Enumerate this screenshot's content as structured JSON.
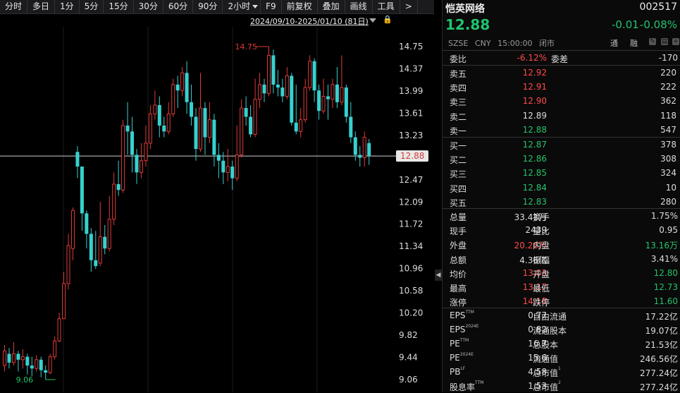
{
  "toolbar": {
    "items": [
      "分时",
      "多日",
      "1分",
      "5分",
      "15分",
      "30分",
      "60分",
      "90分",
      "2小时",
      "F9",
      "前复权",
      "叠加",
      "画线",
      "工具",
      ">"
    ]
  },
  "chart": {
    "range": "2024/09/10-2025/01/10 (81日)",
    "current_price_tag": "12.88",
    "high_marker": "14.75",
    "low_marker": "9.06",
    "y_ticks": [
      "14.75",
      "14.37",
      "13.99",
      "13.61",
      "13.23",
      "12.85",
      "12.47",
      "12.09",
      "11.72",
      "11.34",
      "10.96",
      "10.58",
      "10.20",
      "9.82",
      "9.44",
      "9.06"
    ],
    "colors": {
      "up": "#e03a3a",
      "down": "#36d1cf",
      "last_line": "#d0d0d0"
    }
  },
  "chart_data": {
    "type": "candlestick",
    "ylim": [
      9.06,
      14.75
    ],
    "current": 12.88,
    "candles": [
      [
        9.3,
        9.55,
        9.65,
        9.2
      ],
      [
        9.5,
        9.35,
        9.6,
        9.25
      ],
      [
        9.35,
        9.5,
        9.7,
        9.3
      ],
      [
        9.5,
        9.4,
        9.55,
        9.2
      ],
      [
        9.4,
        9.45,
        9.58,
        9.25
      ],
      [
        9.45,
        9.3,
        9.5,
        9.15
      ],
      [
        9.3,
        9.25,
        9.45,
        9.12
      ],
      [
        9.25,
        9.4,
        9.48,
        9.2
      ],
      [
        9.4,
        9.22,
        9.45,
        9.1
      ],
      [
        9.22,
        9.18,
        9.3,
        9.06
      ],
      [
        9.18,
        9.45,
        9.5,
        9.15
      ],
      [
        9.45,
        9.72,
        9.8,
        9.4
      ],
      [
        9.72,
        10.1,
        10.2,
        9.7
      ],
      [
        10.1,
        10.7,
        10.9,
        10.1
      ],
      [
        10.7,
        11.35,
        11.55,
        10.6
      ],
      [
        11.3,
        11.95,
        12.0,
        11.1
      ],
      [
        12.95,
        12.7,
        13.05,
        12.5
      ],
      [
        12.7,
        11.9,
        12.4,
        11.6
      ],
      [
        11.9,
        11.55,
        11.95,
        11.3
      ],
      [
        11.55,
        11.1,
        11.65,
        10.9
      ],
      [
        11.1,
        11.0,
        11.6,
        10.95
      ],
      [
        11.05,
        11.5,
        12.1,
        11.0
      ],
      [
        11.5,
        11.3,
        11.7,
        11.2
      ],
      [
        11.3,
        11.8,
        12.2,
        11.25
      ],
      [
        11.8,
        12.4,
        12.6,
        11.7
      ],
      [
        12.4,
        12.3,
        12.8,
        12.2
      ],
      [
        12.3,
        13.4,
        13.5,
        12.25
      ],
      [
        13.4,
        13.3,
        13.8,
        12.9
      ],
      [
        13.3,
        12.9,
        13.55,
        12.6
      ],
      [
        12.9,
        12.6,
        13.0,
        12.4
      ],
      [
        12.6,
        12.8,
        13.1,
        12.5
      ],
      [
        12.8,
        13.1,
        13.4,
        12.7
      ],
      [
        13.1,
        13.6,
        13.75,
        13.0
      ],
      [
        13.6,
        13.75,
        14.0,
        13.5
      ],
      [
        13.75,
        13.4,
        13.9,
        13.2
      ],
      [
        13.4,
        13.3,
        13.55,
        13.2
      ],
      [
        13.3,
        13.6,
        13.8,
        13.25
      ],
      [
        13.6,
        14.1,
        14.2,
        13.55
      ],
      [
        14.1,
        14.0,
        14.25,
        13.7
      ],
      [
        14.0,
        14.3,
        14.4,
        13.9
      ],
      [
        14.3,
        13.8,
        14.5,
        13.6
      ],
      [
        13.8,
        13.55,
        14.1,
        13.4
      ],
      [
        13.55,
        13.0,
        13.7,
        12.8
      ],
      [
        13.0,
        13.7,
        14.3,
        12.95
      ],
      [
        13.7,
        13.2,
        13.8,
        12.9
      ],
      [
        13.2,
        13.5,
        13.8,
        13.1
      ],
      [
        13.5,
        12.9,
        13.6,
        12.7
      ],
      [
        12.9,
        12.8,
        13.1,
        12.5
      ],
      [
        12.8,
        12.6,
        12.95,
        12.4
      ],
      [
        12.6,
        12.7,
        13.0,
        12.45
      ],
      [
        12.7,
        12.5,
        12.8,
        12.3
      ],
      [
        12.5,
        12.9,
        13.4,
        12.45
      ],
      [
        12.9,
        13.7,
        13.85,
        12.85
      ],
      [
        13.7,
        13.55,
        13.9,
        13.4
      ],
      [
        13.55,
        13.25,
        13.75,
        13.2
      ],
      [
        13.25,
        13.85,
        14.2,
        13.2
      ],
      [
        13.85,
        14.1,
        14.3,
        13.7
      ],
      [
        14.1,
        13.95,
        14.2,
        13.8
      ],
      [
        13.95,
        14.6,
        14.75,
        13.9
      ],
      [
        14.6,
        14.1,
        14.7,
        13.95
      ],
      [
        14.1,
        14.05,
        14.35,
        13.9
      ],
      [
        14.05,
        13.9,
        14.2,
        13.8
      ],
      [
        13.9,
        14.25,
        14.4,
        13.85
      ],
      [
        14.25,
        13.45,
        14.3,
        13.4
      ],
      [
        13.45,
        13.3,
        14.1,
        13.25
      ],
      [
        13.3,
        13.5,
        13.7,
        13.2
      ],
      [
        13.5,
        14.05,
        14.2,
        13.45
      ],
      [
        14.05,
        14.5,
        14.6,
        14.0
      ],
      [
        14.5,
        14.0,
        14.55,
        13.8
      ],
      [
        14.0,
        13.65,
        14.1,
        13.5
      ],
      [
        13.65,
        13.9,
        14.2,
        13.6
      ],
      [
        13.9,
        13.85,
        14.1,
        13.5
      ],
      [
        13.85,
        14.1,
        14.2,
        13.7
      ],
      [
        14.1,
        13.8,
        14.4,
        13.7
      ],
      [
        13.8,
        14.05,
        14.6,
        13.75
      ],
      [
        14.05,
        13.55,
        14.1,
        13.45
      ],
      [
        13.55,
        13.2,
        13.8,
        13.1
      ],
      [
        13.2,
        12.9,
        13.3,
        12.8
      ],
      [
        12.9,
        12.85,
        13.05,
        12.7
      ],
      [
        12.85,
        13.2,
        13.3,
        12.7
      ],
      [
        13.1,
        12.88,
        13.17,
        12.73
      ]
    ]
  },
  "quote": {
    "name": "恺英网络",
    "code": "002517",
    "price": "12.88",
    "change": "-0.01",
    "change_pct": "-0.08%",
    "market": "SZSE",
    "currency": "CNY",
    "time": "15:00:00",
    "status": "闭市",
    "tong": "通",
    "rong": "融"
  },
  "order_book": {
    "weibi_label": "委比",
    "weibi": "-6.12%",
    "weicha_label": "委差",
    "weicha": "-170",
    "asks": [
      {
        "label": "卖五",
        "price": "12.92",
        "qty": "220"
      },
      {
        "label": "卖四",
        "price": "12.91",
        "qty": "222"
      },
      {
        "label": "卖三",
        "price": "12.90",
        "qty": "362"
      },
      {
        "label": "卖二",
        "price": "12.89",
        "qty": "118"
      },
      {
        "label": "卖一",
        "price": "12.88",
        "qty": "547"
      }
    ],
    "bids": [
      {
        "label": "买一",
        "price": "12.87",
        "qty": "378"
      },
      {
        "label": "买二",
        "price": "12.86",
        "qty": "308"
      },
      {
        "label": "买三",
        "price": "12.85",
        "qty": "324"
      },
      {
        "label": "买四",
        "price": "12.84",
        "qty": "10"
      },
      {
        "label": "买五",
        "price": "12.83",
        "qty": "280"
      }
    ]
  },
  "stats": [
    {
      "l1": "总量",
      "v1": "33.41万",
      "l2": "换手",
      "v2": "1.75%"
    },
    {
      "l1": "现手",
      "v1": "2439",
      "l2": "量比",
      "v2": "0.95"
    },
    {
      "l1": "外盘",
      "v1": "20.26万",
      "l2": "内盘",
      "v2": "13.16万"
    },
    {
      "l1": "总额",
      "v1": "4.36亿",
      "l2": "振幅",
      "v2": "3.41%"
    },
    {
      "l1": "均价",
      "v1": "13.03",
      "l2": "开盘",
      "v2": "12.80"
    },
    {
      "l1": "最高",
      "v1": "13.17",
      "l2": "最低",
      "v2": "12.73"
    },
    {
      "l1": "涨停",
      "v1": "14.18",
      "l2": "跌停",
      "v2": "11.60"
    }
  ],
  "fundamentals": [
    {
      "l1": "EPS",
      "s1": "TTM",
      "v1": "0.77",
      "l2": "自由流通",
      "v2": "17.22亿"
    },
    {
      "l1": "EPS",
      "s1": "2024E",
      "v1": "0.82",
      "l2": "流通股本",
      "v2": "19.07亿"
    },
    {
      "l1": "PE",
      "s1": "TTM",
      "v1": "16.7",
      "l2": "总股本",
      "v2": "21.53亿"
    },
    {
      "l1": "PE",
      "s1": "2024E",
      "v1": "15.6",
      "l2": "流通值",
      "v2": "246.56亿"
    },
    {
      "l1": "PB",
      "s1": "LF",
      "v1": "4.58",
      "l2": "总市值",
      "s2": "1",
      "v2": "277.24亿"
    },
    {
      "l1": "股息率",
      "s1": "TTM",
      "v1": "1.53",
      "l2": "总市值",
      "s2": "2",
      "v2": "277.24亿"
    }
  ]
}
